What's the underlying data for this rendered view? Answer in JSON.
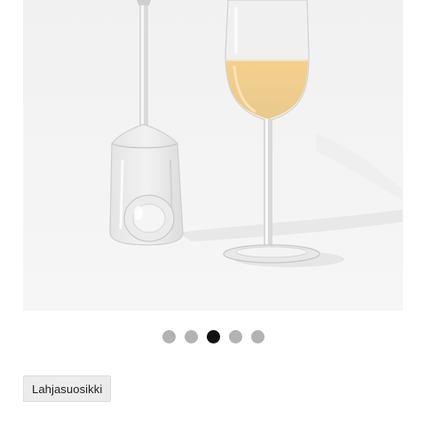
{
  "product": {
    "image": {
      "icon": "wine-glasses-photo"
    }
  },
  "carousel": {
    "slide_count": 5,
    "active_index": 2,
    "colors": {
      "inactive": "#b3b3b3",
      "active": "#111111"
    }
  },
  "tags": [
    {
      "label": "Lahjasuosikki"
    }
  ]
}
